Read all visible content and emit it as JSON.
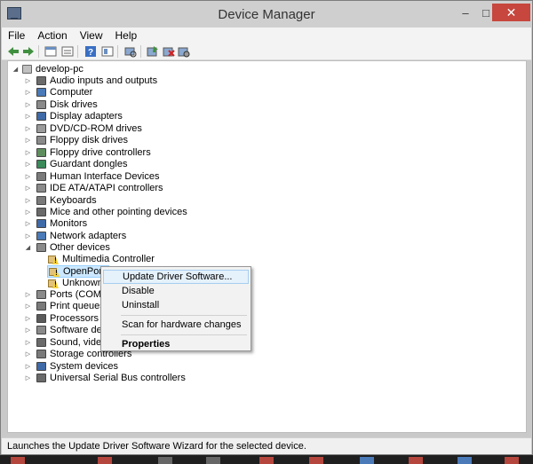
{
  "window": {
    "title": "Device Manager",
    "minimize": "–",
    "maximize": "□",
    "close": "✕"
  },
  "menu": [
    "File",
    "Action",
    "View",
    "Help"
  ],
  "toolbar": {
    "buttons": [
      "back-arrow-icon",
      "forward-arrow-icon",
      "properties-icon",
      "tree-view-icon",
      "help-icon",
      "device-view-icon",
      "scan-hardware-icon",
      "update-driver-icon",
      "uninstall-icon",
      "disable-icon"
    ],
    "colors": {
      "arrow": "#3f8f3f",
      "help": "#3a6fc4",
      "uninstall": "#d02020"
    }
  },
  "tree": {
    "root": "develop-pc",
    "categories": [
      {
        "label": "Audio inputs and outputs",
        "icon": "speaker-icon",
        "color": "#6b6b6b"
      },
      {
        "label": "Computer",
        "icon": "computer-icon",
        "color": "#4a7ab8"
      },
      {
        "label": "Disk drives",
        "icon": "disk-drive-icon",
        "color": "#8a8a8a"
      },
      {
        "label": "Display adapters",
        "icon": "display-adapter-icon",
        "color": "#3f6aa8"
      },
      {
        "label": "DVD/CD-ROM drives",
        "icon": "dvd-drive-icon",
        "color": "#9a9a9a"
      },
      {
        "label": "Floppy disk drives",
        "icon": "floppy-disk-icon",
        "color": "#8a8a8a"
      },
      {
        "label": "Floppy drive controllers",
        "icon": "floppy-controller-icon",
        "color": "#5e8e5e"
      },
      {
        "label": "Guardant dongles",
        "icon": "dongle-icon",
        "color": "#3a8a5a"
      },
      {
        "label": "Human Interface Devices",
        "icon": "hid-icon",
        "color": "#7a7a7a"
      },
      {
        "label": "IDE ATA/ATAPI controllers",
        "icon": "ide-controller-icon",
        "color": "#8a8a8a"
      },
      {
        "label": "Keyboards",
        "icon": "keyboard-icon",
        "color": "#7a7a7a"
      },
      {
        "label": "Mice and other pointing devices",
        "icon": "mouse-icon",
        "color": "#6a6a6a"
      },
      {
        "label": "Monitors",
        "icon": "monitor-icon",
        "color": "#3f6aa8"
      },
      {
        "label": "Network adapters",
        "icon": "network-adapter-icon",
        "color": "#4a7ab8"
      },
      {
        "label": "Other devices",
        "icon": "other-devices-icon",
        "color": "#8a8a8a"
      }
    ],
    "other_devices_children": [
      {
        "label": "Multimedia Controller"
      },
      {
        "label": "OpenPort 2"
      },
      {
        "label": "Unknown d"
      }
    ],
    "categories_after": [
      {
        "label": "Ports (COM &",
        "icon": "port-icon",
        "color": "#8a8a8a"
      },
      {
        "label": "Print queues",
        "icon": "printer-icon",
        "color": "#7a7a7a"
      },
      {
        "label": "Processors",
        "icon": "processor-icon",
        "color": "#5a5a5a"
      },
      {
        "label": "Software devic",
        "icon": "software-device-icon",
        "color": "#8a8a8a"
      },
      {
        "label": "Sound, video a",
        "icon": "sound-icon",
        "color": "#6a6a6a"
      },
      {
        "label": "Storage controllers",
        "icon": "storage-controller-icon",
        "color": "#7a7a7a"
      },
      {
        "label": "System devices",
        "icon": "system-device-icon",
        "color": "#3f6aa8"
      },
      {
        "label": "Universal Serial Bus controllers",
        "icon": "usb-icon",
        "color": "#6a6a6a"
      }
    ]
  },
  "context_menu": {
    "update": "Update Driver Software...",
    "disable": "Disable",
    "uninstall": "Uninstall",
    "scan": "Scan for hardware changes",
    "properties": "Properties"
  },
  "status": "Launches the Update Driver Software Wizard for the selected device."
}
